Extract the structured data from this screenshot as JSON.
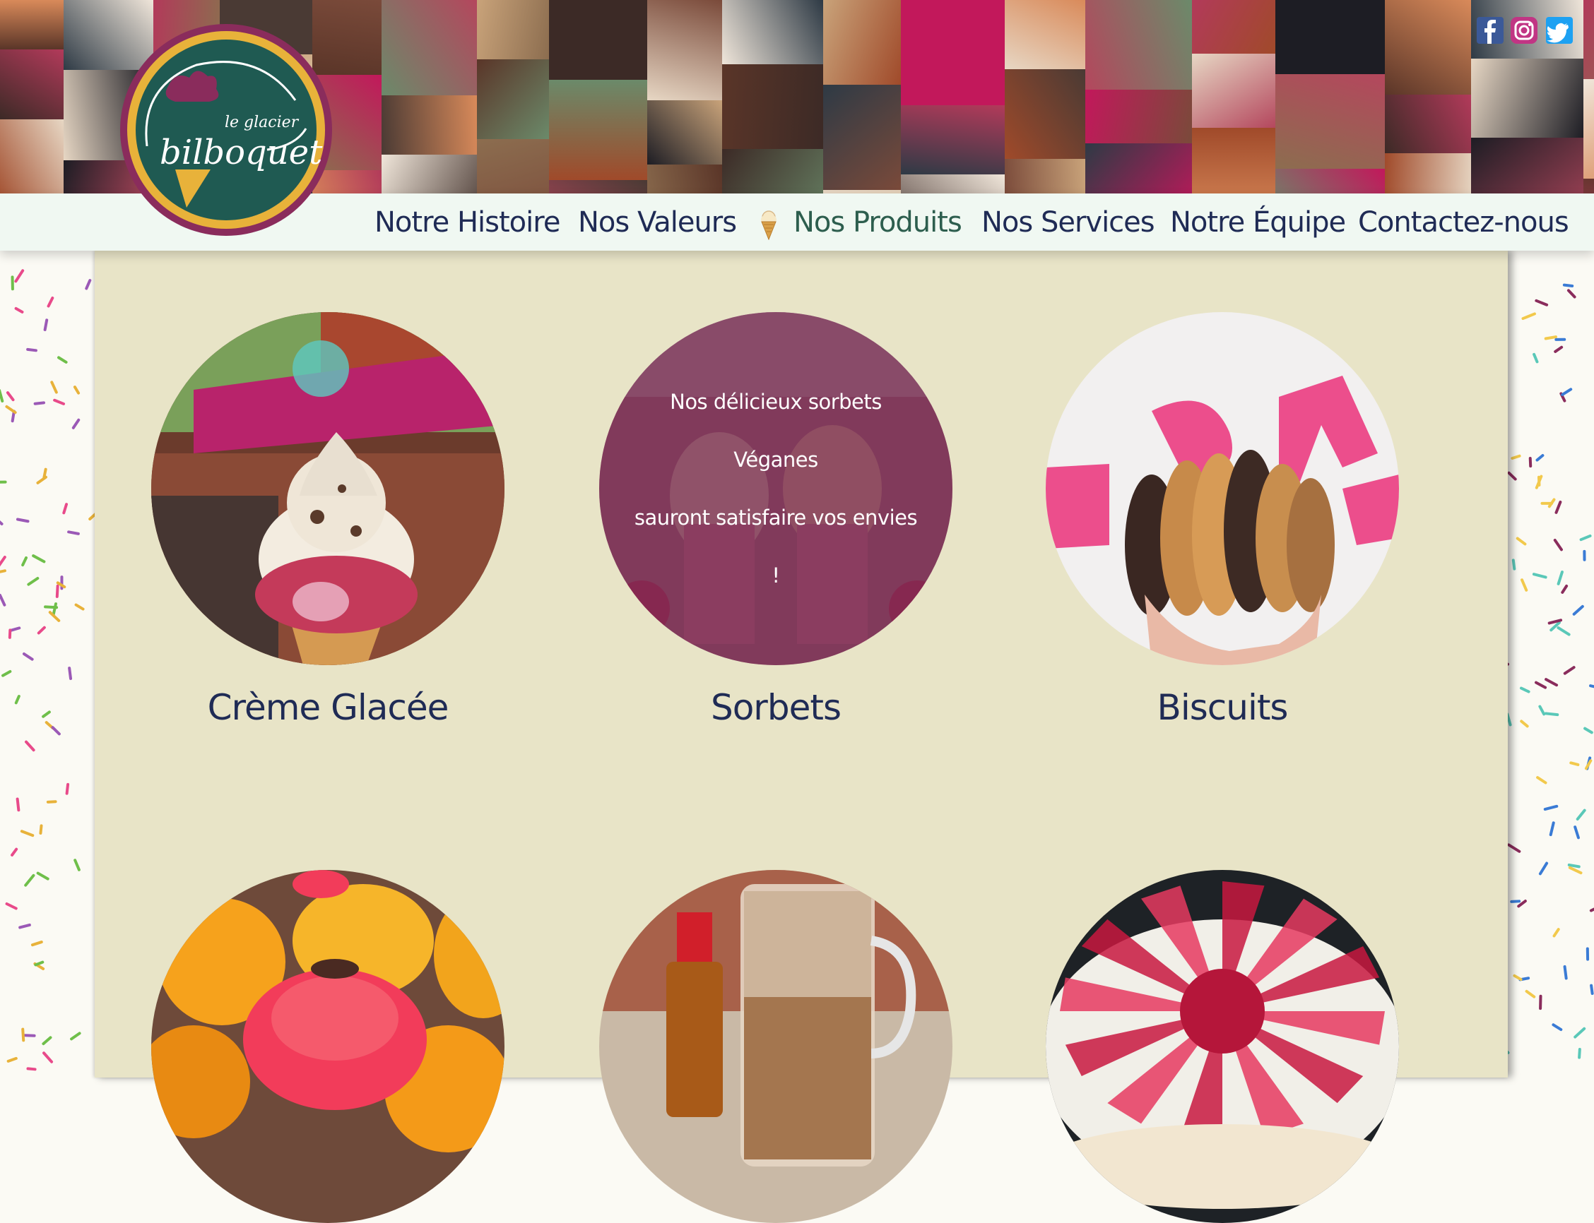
{
  "brand": {
    "logo_small_text": "le glacier",
    "logo_main_text": "bilboquet",
    "colors": {
      "teal": "#1f5a52",
      "plum": "#8a2c5c",
      "gold": "#e8b23a",
      "navy": "#1f2b55",
      "cream": "#e8e4c7"
    }
  },
  "social": [
    {
      "name": "facebook",
      "icon": "facebook-icon",
      "color": "#3b5998"
    },
    {
      "name": "instagram",
      "icon": "instagram-icon",
      "color": "#c13584"
    },
    {
      "name": "twitter",
      "icon": "twitter-icon",
      "color": "#1da1f2"
    }
  ],
  "nav": {
    "items": [
      {
        "label": "Notre Histoire"
      },
      {
        "label": "Nos Valeurs"
      },
      {
        "label": "Nos Produits",
        "active": true,
        "icon": "ice-cream-cone-icon"
      },
      {
        "label": "Nos Services"
      },
      {
        "label": "Notre Équipe"
      },
      {
        "label": "Contactez-nous"
      }
    ]
  },
  "products": [
    {
      "name": "Crème Glacée"
    },
    {
      "name": "Sorbets",
      "hover_text_line1": "Nos délicieux sorbets Véganes",
      "hover_text_line2": "sauront satisfaire vos envies !"
    },
    {
      "name": "Biscuits"
    },
    {
      "name": ""
    },
    {
      "name": ""
    },
    {
      "name": ""
    }
  ]
}
